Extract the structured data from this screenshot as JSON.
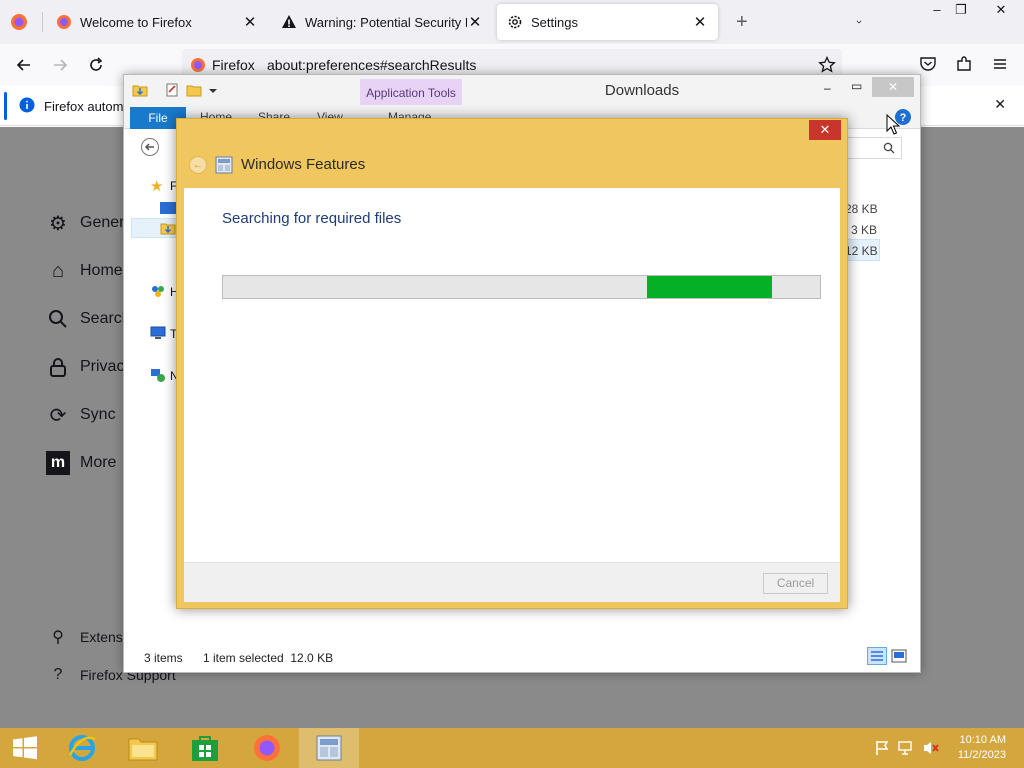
{
  "firefox": {
    "tabs": [
      {
        "label": "Welcome to Firefox"
      },
      {
        "label": "Warning: Potential Security Risk"
      },
      {
        "label": "Settings"
      }
    ],
    "new_tab": "+",
    "list_tabs": "⌄",
    "win_min": "–",
    "win_max": "❐",
    "win_close": "✕",
    "identity": "Firefox",
    "url": "about:preferences#searchResults",
    "notice": "Firefox automa",
    "notice_close": "✕"
  },
  "preferences": {
    "nav": [
      {
        "label": "Gener",
        "icon": "gear-icon"
      },
      {
        "label": "Home",
        "icon": "home-icon"
      },
      {
        "label": "Search",
        "icon": "search-icon"
      },
      {
        "label": "Privac",
        "icon": "lock-icon"
      },
      {
        "label": "Sync",
        "icon": "sync-icon"
      },
      {
        "label": "More",
        "icon": "mozilla-icon"
      }
    ],
    "footer": [
      {
        "label": "Extensio"
      },
      {
        "label": "Firefox Support"
      }
    ]
  },
  "explorer": {
    "title": "Downloads",
    "app_tools": "Application Tools",
    "ribbon_tabs": [
      "File",
      "Home",
      "Share",
      "View",
      "Manage"
    ],
    "tree_labels": [
      "F",
      "H",
      "T",
      "N"
    ],
    "file_sizes": [
      "28 KB",
      "3 KB",
      "12 KB"
    ],
    "status_items": "3 items",
    "status_selected": "1 item selected  12.0 KB"
  },
  "dialog": {
    "title": "Windows Features",
    "status": "Searching for required files",
    "progress_start": 0.71,
    "progress_fill": 0.21,
    "cancel": "Cancel",
    "close": "✕",
    "progress_color": "#06b025"
  },
  "taskbar": {
    "time": "10:10 AM",
    "date": "11/2/2023",
    "items": [
      "start-icon",
      "internet-explorer-icon",
      "file-explorer-icon",
      "store-icon",
      "firefox-icon",
      "windows-features-icon"
    ]
  }
}
